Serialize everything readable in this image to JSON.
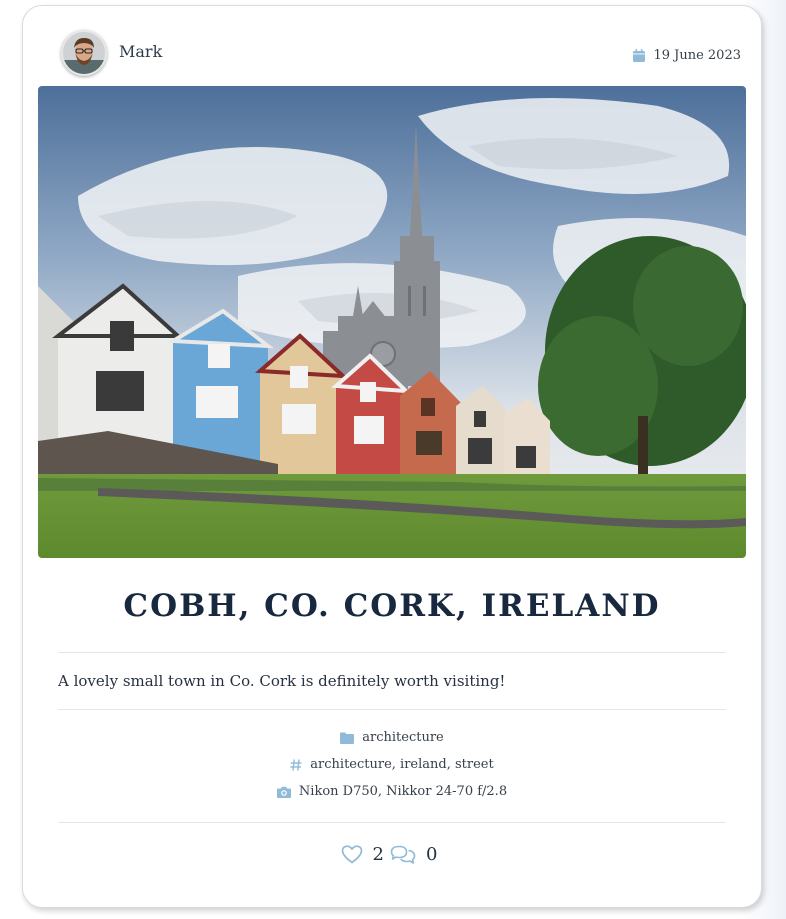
{
  "post": {
    "author": {
      "name": "Mark",
      "avatar_icon": "avatar-photo"
    },
    "date": "19 June 2023",
    "title": "COBH, CO. CORK, IRELAND",
    "description": "A lovely small town in Co. Cork is definitely worth visiting!",
    "category": "architecture",
    "tags": "architecture, ireland, street",
    "camera": "Nikon D750, Nikkor 24-70 f/2.8",
    "likes": "2",
    "comments": "0"
  },
  "icons": {
    "date": "calendar-icon",
    "category": "folder-icon",
    "tags": "hashtag-icon",
    "camera": "camera-icon",
    "likes": "heart-icon",
    "comments": "comments-icon"
  },
  "colors": {
    "accent": "#8fbbd9",
    "title": "#17283f",
    "text": "#26323f"
  }
}
